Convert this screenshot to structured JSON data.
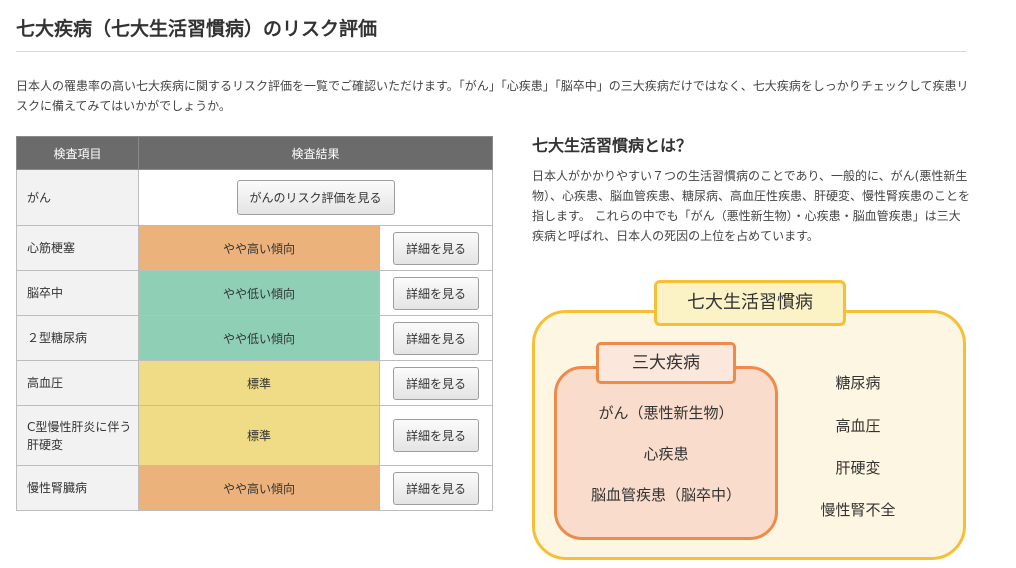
{
  "page": {
    "title": "七大疾病（七大生活習慣病）のリスク評価",
    "intro": "日本人の罹患率の高い七大疾病に関するリスク評価を一覧でご確認いただけます。「がん」「心疾患」「脳卒中」の三大疾病だけではなく、七大疾病をしっかりチェックして疾患リスクに備えてみてはいかがでしょうか。"
  },
  "table": {
    "headers": [
      "検査項目",
      "検査結果"
    ],
    "rows": [
      {
        "item": "がん",
        "button": "がんのリスク評価を見る"
      },
      {
        "item": "心筋梗塞",
        "result": "やや高い傾向",
        "level": "high",
        "button": "詳細を見る"
      },
      {
        "item": "脳卒中",
        "result": "やや低い傾向",
        "level": "low",
        "button": "詳細を見る"
      },
      {
        "item": "２型糖尿病",
        "result": "やや低い傾向",
        "level": "low",
        "button": "詳細を見る"
      },
      {
        "item": "高血圧",
        "result": "標準",
        "level": "standard",
        "button": "詳細を見る"
      },
      {
        "item": "C型慢性肝炎に伴う肝硬変",
        "result": "標準",
        "level": "standard",
        "button": "詳細を見る"
      },
      {
        "item": "慢性腎臓病",
        "result": "やや高い傾向",
        "level": "high",
        "button": "詳細を見る"
      }
    ],
    "colors": {
      "high": "#ebb27c",
      "low": "#8ecfb5",
      "standard": "#f0dc87",
      "header": "#6b6b6b"
    }
  },
  "side": {
    "heading": "七大生活習慣病とは？",
    "text": "日本人がかかりやすい７つの生活習慣病のことであり、一般的に、がん(悪性新生物）、心疾患、脳血管疾患、糖尿病、高血圧性疾患、肝硬変、慢性腎疾患のことを指します。 これらの中でも「がん（悪性新生物）・心疾患・脳血管疾患」は三大疾病と呼ばれ、日本人の死因の上位を占めています。"
  },
  "diagram": {
    "outer_label": "七大生活習慣病",
    "inner_label": "三大疾病",
    "inner_items": [
      "がん（悪性新生物）",
      "心疾患",
      "脳血管疾患（脳卒中）"
    ],
    "outer_items": [
      "糖尿病",
      "高血圧",
      "肝硬変",
      "慢性腎不全"
    ],
    "colors": {
      "outer": "#f5c036",
      "inner": "#ee8a4a"
    }
  }
}
